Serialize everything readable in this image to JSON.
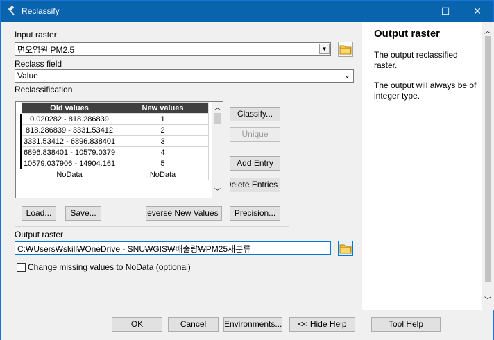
{
  "window": {
    "title": "Reclassify",
    "minimize": "—",
    "maximize": "☐",
    "close": "✕"
  },
  "input_raster": {
    "label": "Input raster",
    "value": "면오염원 PM2.5"
  },
  "reclass_field": {
    "label": "Reclass field",
    "value": "Value"
  },
  "reclassification": {
    "label": "Reclassification",
    "columns": [
      "Old values",
      "New values"
    ],
    "rows": [
      {
        "old": "0.020282 - 818.286839",
        "new": "1"
      },
      {
        "old": "818.286839 - 3331.53412",
        "new": "2"
      },
      {
        "old": "3331.53412 - 6896.838401",
        "new": "3"
      },
      {
        "old": "6896.838401 - 10579.0379",
        "new": "4"
      },
      {
        "old": "10579.037906 - 14904.161",
        "new": "5"
      },
      {
        "old": "NoData",
        "new": "NoData"
      }
    ],
    "buttons": {
      "classify": "Classify...",
      "unique": "Unique",
      "add_entry": "Add Entry",
      "delete_entries": "Delete Entries",
      "load": "Load...",
      "save": "Save...",
      "reverse": "Reverse New Values",
      "precision": "Precision..."
    }
  },
  "output_raster": {
    "label": "Output raster",
    "value": "C:₩Users₩skill₩OneDrive - SNU₩GIS₩배출량₩PM25재분류"
  },
  "missing_values": {
    "label": "Change missing values to NoData (optional)",
    "checked": false
  },
  "help": {
    "title": "Output raster",
    "para1": "The output reclassified raster.",
    "para2": "The output will always be of integer type."
  },
  "footer": {
    "ok": "OK",
    "cancel": "Cancel",
    "environments": "Environments...",
    "hide_help": "<< Hide Help",
    "tool_help": "Tool Help"
  }
}
